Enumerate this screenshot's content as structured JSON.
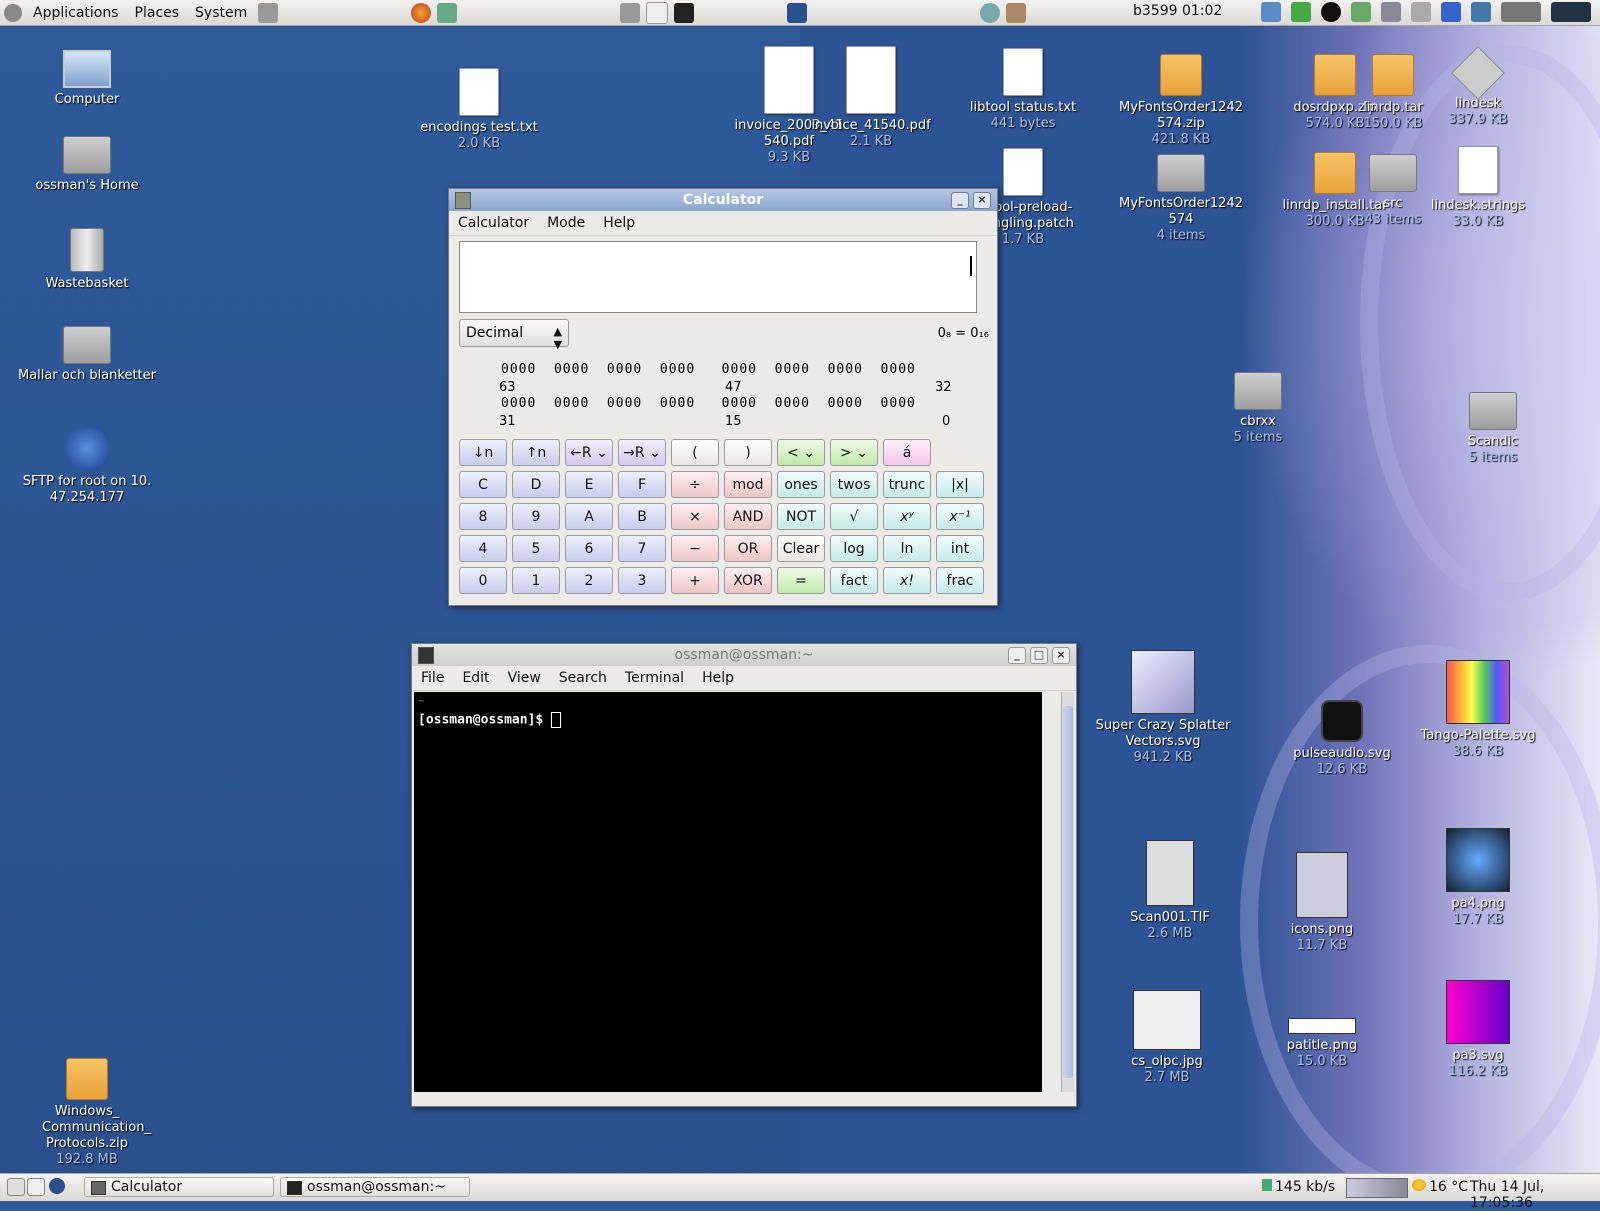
{
  "top_panel": {
    "menus": [
      "Applications",
      "Places",
      "System"
    ],
    "clock": "b3599 01:02"
  },
  "desktop_left": [
    {
      "label": "Computer",
      "sub": ""
    },
    {
      "label": "ossman's Home",
      "sub": ""
    },
    {
      "label": "Wastebasket",
      "sub": ""
    },
    {
      "label": "Mallar och blanketter",
      "sub": ""
    },
    {
      "label": "SFTP for root on 10. 47.254.177",
      "sub": ""
    },
    {
      "label": "Windows_ Communication_ Protocols.zip",
      "sub": "192.8 MB"
    }
  ],
  "desktop_files": [
    {
      "label": "encodings test.txt",
      "sub": "2.0 KB"
    },
    {
      "label": "invoice_2009_41540.pdf",
      "sub": "9.3 KB"
    },
    {
      "label": "invoice_41540.pdf",
      "sub": "2.1 KB"
    },
    {
      "label": "libtool status.txt",
      "sub": "441 bytes"
    },
    {
      "label": "MyFontsOrder1242574.zip",
      "sub": "421.8 KB"
    },
    {
      "label": "dosrdpxp.zip",
      "sub": "574.0 KB"
    },
    {
      "label": "linrdp.tar",
      "sub": "150.0 KB"
    },
    {
      "label": "lindesk",
      "sub": "337.9 KB"
    },
    {
      "label": "libtool-preload-mangling.patch",
      "sub": "1.7 KB"
    },
    {
      "label": "MyFontsOrder1242574",
      "sub": "4 items"
    },
    {
      "label": "linrdp_install.tar",
      "sub": "300.0 KB"
    },
    {
      "label": "src",
      "sub": "43 items"
    },
    {
      "label": "lindesk.strings",
      "sub": "33.0 KB"
    },
    {
      "label": "cbrxx",
      "sub": "5 items"
    },
    {
      "label": "Scandic",
      "sub": "5 items"
    },
    {
      "label": "Super Crazy Splatter Vectors.svg",
      "sub": "941.2 KB"
    },
    {
      "label": "pulseaudio.svg",
      "sub": "12.6 KB"
    },
    {
      "label": "Tango-Palette.svg",
      "sub": "38.6 KB"
    },
    {
      "label": "Scan001.TIF",
      "sub": "2.6 MB"
    },
    {
      "label": "icons.png",
      "sub": "11.7 KB"
    },
    {
      "label": "pa4.png",
      "sub": "17.7 KB"
    },
    {
      "label": "cs_olpc.jpg",
      "sub": "2.7 MB"
    },
    {
      "label": "patitle.png",
      "sub": "15.0 KB"
    },
    {
      "label": "pa3.svg",
      "sub": "116.2 KB"
    }
  ],
  "calculator": {
    "title": "Calculator",
    "menus": [
      "Calculator",
      "Mode",
      "Help"
    ],
    "mode": "Decimal",
    "base_info": "0₈ = 0₁₆",
    "bits_row1": "0000  0000  0000  0000   0000  0000  0000  0000",
    "bits_row2": "0000  0000  0000  0000   0000  0000  0000  0000",
    "bit_labels_row1": [
      "63",
      "47",
      "32"
    ],
    "bit_labels_row2": [
      "31",
      "15",
      "0"
    ],
    "buttons": [
      [
        "↓n",
        "↑n",
        "←R",
        "→R",
        "(",
        ")",
        "<",
        ">",
        "á"
      ],
      [
        "C",
        "D",
        "E",
        "F",
        "÷",
        "mod",
        "ones",
        "twos",
        "trunc",
        "|x|"
      ],
      [
        "8",
        "9",
        "A",
        "B",
        "×",
        "AND",
        "NOT",
        "√",
        "xʸ",
        "x⁻¹"
      ],
      [
        "4",
        "5",
        "6",
        "7",
        "−",
        "OR",
        "Clear",
        "log",
        "ln",
        "int"
      ],
      [
        "0",
        "1",
        "2",
        "3",
        "+",
        "XOR",
        "=",
        "fact",
        "x!",
        "frac"
      ]
    ]
  },
  "terminal": {
    "title": "ossman@ossman:~",
    "menus": [
      "File",
      "Edit",
      "View",
      "Search",
      "Terminal",
      "Help"
    ],
    "line0": "~",
    "prompt": "[ossman@ossman]$ "
  },
  "bottom_panel": {
    "tasks": [
      "Calculator",
      "ossman@ossman:~"
    ],
    "netspeed": "145 kb/s",
    "weather": "16 °C",
    "datetime": "Thu 14 Jul, 17:05:36"
  }
}
